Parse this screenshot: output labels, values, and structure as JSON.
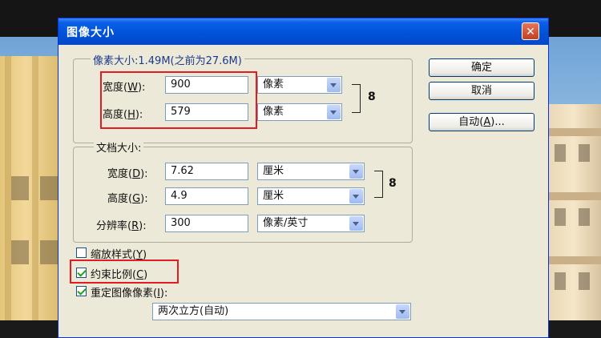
{
  "dialog": {
    "title": "图像大小",
    "close_glyph": "✕",
    "pixel_dimensions": {
      "title": "像素大小:1.49M(之前为27.6M)",
      "width": {
        "label": "宽度(",
        "key": "W",
        "suffix": "):",
        "value": "900",
        "unit": "像素"
      },
      "height": {
        "label": "高度(",
        "key": "H",
        "suffix": "):",
        "value": "579",
        "unit": "像素"
      }
    },
    "document_size": {
      "title": "文档大小:",
      "width": {
        "label": "宽度(",
        "key": "D",
        "suffix": "):",
        "value": "7.62",
        "unit": "厘米"
      },
      "height": {
        "label": "高度(",
        "key": "G",
        "suffix": "):",
        "value": "4.9",
        "unit": "厘米"
      },
      "resolution": {
        "label": "分辨率(",
        "key": "R",
        "suffix": "):",
        "value": "300",
        "unit": "像素/英寸"
      }
    },
    "options": {
      "scale_styles": {
        "label": "缩放样式(",
        "key": "Y",
        "suffix": ")",
        "checked": false
      },
      "constrain": {
        "label": "约束比例(",
        "key": "C",
        "suffix": ")",
        "checked": true
      },
      "resample": {
        "label": "重定图像像素(",
        "key": "I",
        "suffix": "):",
        "checked": true
      },
      "method": "两次立方(自动)"
    },
    "buttons": {
      "ok": "确定",
      "cancel": "取消",
      "auto": {
        "label": "自动(",
        "key": "A",
        "suffix": ")..."
      }
    },
    "link_glyph": "8"
  },
  "colors": {
    "titlebar": "#0a5fe8",
    "dialog_bg": "#ece9d8",
    "highlight_box": "#e31b23"
  }
}
